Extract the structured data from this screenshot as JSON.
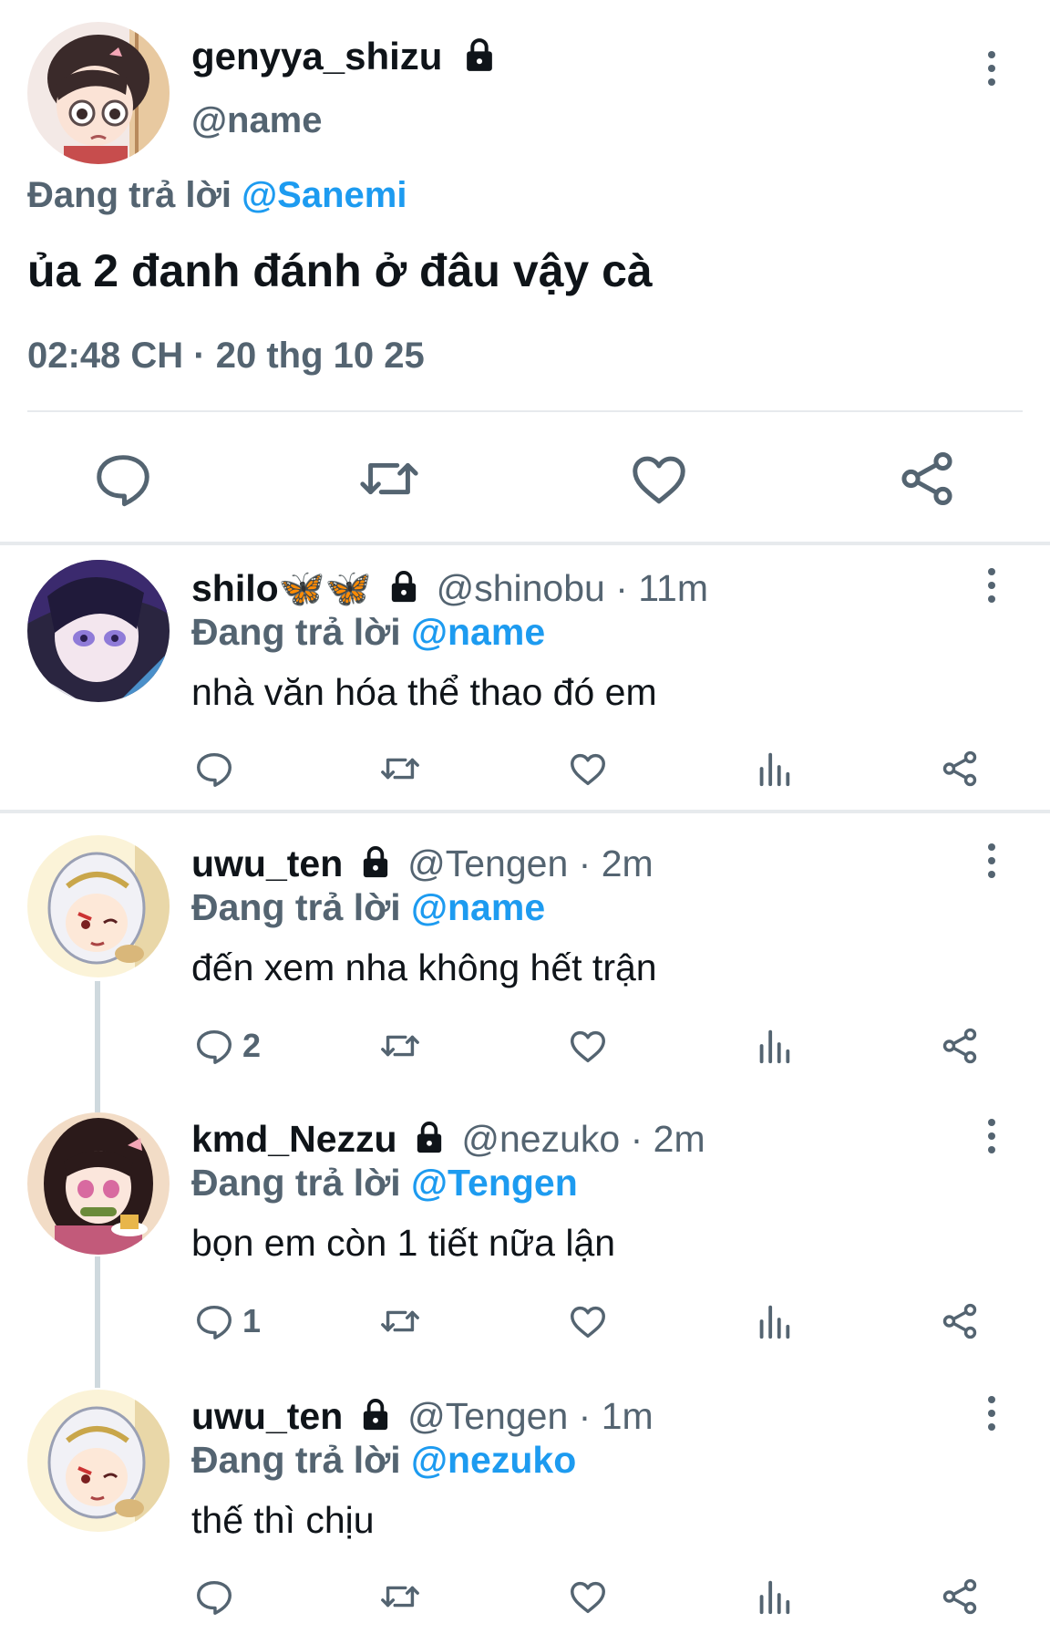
{
  "main_tweet": {
    "display_name": "genyya_shizu",
    "handle": "@name",
    "replying_prefix": "Đang trả lời",
    "replying_to": "@Sanemi",
    "text": "ủa 2 đanh đánh ở đâu vậy cà",
    "timestamp": "02:48 CH · 20 thg 10 25",
    "actions": [
      "reply-icon",
      "retweet-icon",
      "like-icon",
      "share-icon"
    ]
  },
  "replies": [
    {
      "display_name": "shilo🦋🦋",
      "handle": "@shinobu",
      "time": "· 11m",
      "replying_prefix": "Đang trả lời",
      "replying_to": "@name",
      "text": "nhà văn hóa thể thao đó em",
      "reply_count": ""
    },
    {
      "display_name": "uwu_ten",
      "handle": "@Tengen",
      "time": "· 2m",
      "replying_prefix": "Đang trả lời",
      "replying_to": "@name",
      "text": "đến xem nha không hết trận",
      "reply_count": "2"
    },
    {
      "display_name": "kmd_Nezzu",
      "handle": "@nezuko",
      "time": "· 2m",
      "replying_prefix": "Đang trả lời",
      "replying_to": "@Tengen",
      "text": "bọn em còn 1 tiết nữa lận",
      "reply_count": "1"
    },
    {
      "display_name": "uwu_ten",
      "handle": "@Tengen",
      "time": "· 1m",
      "replying_prefix": "Đang trả lời",
      "replying_to": "@nezuko",
      "text": "thế thì chịu",
      "reply_count": ""
    }
  ],
  "colors": {
    "text": "#0f1419",
    "secondary": "#546471",
    "link": "#1d9bf0",
    "divider": "#e7eaed"
  }
}
